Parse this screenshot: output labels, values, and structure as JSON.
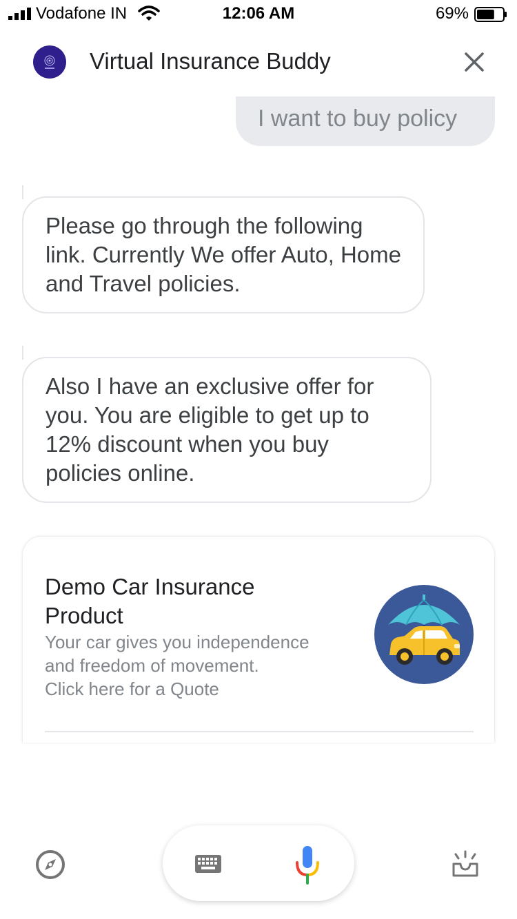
{
  "status_bar": {
    "carrier": "Vodafone IN",
    "time": "12:06 AM",
    "battery_percent": "69%",
    "battery_level": 0.69
  },
  "header": {
    "title": "Virtual Insurance Buddy",
    "avatar_icon": "assistant-logo-icon",
    "close_icon": "close-icon"
  },
  "messages": [
    {
      "from": "user",
      "text": "I want to buy policy"
    },
    {
      "from": "bot",
      "text": "Please go through the following link. Currently We offer Auto, Home and  Travel policies."
    },
    {
      "from": "bot",
      "text": "Also I have an exclusive offer for you. You are eligible to get up to 12% discount when you buy policies online."
    }
  ],
  "card": {
    "title": "Demo Car Insurance Product",
    "description_line1": "Your car gives you independence",
    "description_line2": "and freedom of movement.",
    "description_line3": "Click here for a Quote",
    "image_icon": "car-umbrella-icon",
    "image_bg_color": "#3b5998",
    "umbrella_color": "#4fc3d8",
    "car_color": "#f6c12b"
  },
  "bottom_bar": {
    "explore_icon": "compass-icon",
    "keyboard_icon": "keyboard-icon",
    "mic_icon": "microphone-icon",
    "inbox_icon": "updates-tray-icon"
  }
}
